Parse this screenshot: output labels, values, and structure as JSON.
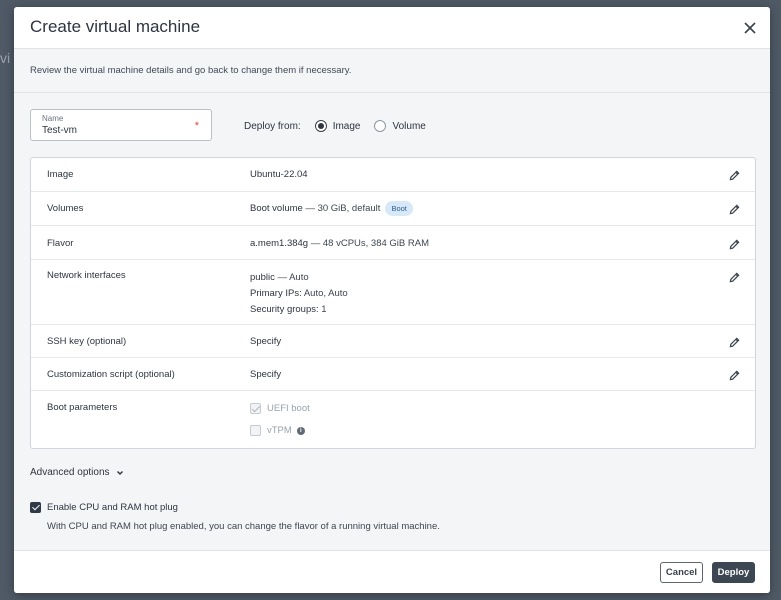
{
  "backdrop": {
    "text": "vi"
  },
  "modal": {
    "title": "Create virtual machine",
    "subtitle": "Review the virtual machine details and go back to change them if necessary."
  },
  "name_field": {
    "label": "Name",
    "value": "Test-vm",
    "required_marker": "*"
  },
  "deploy_from": {
    "label": "Deploy from:",
    "options": [
      {
        "label": "Image",
        "selected": true
      },
      {
        "label": "Volume",
        "selected": false
      }
    ]
  },
  "details": {
    "image": {
      "label": "Image",
      "value": "Ubuntu-22.04"
    },
    "volumes": {
      "label": "Volumes",
      "name": "Boot volume",
      "detail": " — 30 GiB, default",
      "badge": "Boot"
    },
    "flavor": {
      "label": "Flavor",
      "name": "a.mem1.384g",
      "detail": " — 48 vCPUs, 384 GiB RAM"
    },
    "network": {
      "label": "Network interfaces",
      "line1_name": "public",
      "line1_detail": " — Auto",
      "line2_label": "Primary IPs:",
      "line2_value": " Auto, Auto",
      "line3_label": "Security groups:",
      "line3_value": " 1"
    },
    "ssh": {
      "label": "SSH key (optional)",
      "value": "Specify"
    },
    "script": {
      "label": "Customization script (optional)",
      "value": "Specify"
    },
    "boot": {
      "label": "Boot parameters",
      "uefi_label": "UEFI boot",
      "uefi_checked": true,
      "vtpm_label": "vTPM",
      "vtpm_checked": false
    }
  },
  "advanced": {
    "label": "Advanced options"
  },
  "hotplug": {
    "label": "Enable CPU and RAM hot plug",
    "checked": true,
    "description": "With CPU and RAM hot plug enabled, you can change the flavor of a running virtual machine."
  },
  "footer": {
    "cancel_label": "Cancel",
    "deploy_label": "Deploy"
  },
  "colors": {
    "primary_button": "#3d4753",
    "badge_bg": "#d7e8f8",
    "required": "#e0473a"
  }
}
